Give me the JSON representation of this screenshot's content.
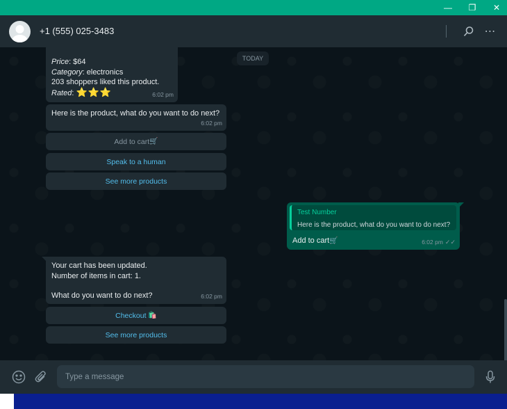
{
  "window": {
    "min_glyph": "—",
    "max_glyph": "❐",
    "close_glyph": "✕"
  },
  "header": {
    "contact_name": "+1 (555) 025-3483",
    "search_icon": "search-icon",
    "menu_icon": "more-options-icon",
    "menu_glyph": "⋯"
  },
  "chat": {
    "date_chip": "TODAY",
    "messages": [
      {
        "price_label": "Price",
        "price_value": ": $64",
        "category_label": "Category",
        "category_value": ": electronics",
        "liked": "203 shoppers liked this product.",
        "rated_label": "Rated",
        "rated_sep": ":",
        "stars": "⭐⭐⭐",
        "time": "6:02 pm"
      },
      {
        "text": "Here is the product, what do you want to do next?",
        "time": "6:02 pm"
      },
      {
        "quote_author": "Test Number",
        "quote_text": "Here is the product, what do you want to do next?",
        "text": "Add to cart",
        "emoji": "🛒",
        "time": "6:02 pm",
        "ticks": "✓✓"
      },
      {
        "line1": "Your cart has been updated.",
        "line2": "Number of items in cart: 1.",
        "line3": "What do you want to do next?",
        "time": "6:02 pm"
      }
    ],
    "replies_1": [
      {
        "label": "Add to cart",
        "emoji": "🛒",
        "state": "disabled"
      },
      {
        "label": "Speak to a human"
      },
      {
        "label": "See more products"
      }
    ],
    "replies_2": [
      {
        "label": "Checkout",
        "emoji": "🛍️"
      },
      {
        "label": "See more products"
      }
    ]
  },
  "composer": {
    "placeholder": "Type a message",
    "emoji_icon": "emoji-icon",
    "attach_icon": "paperclip-icon",
    "mic_icon": "microphone-icon"
  },
  "colors": {
    "accent": "#00a884",
    "header_bg": "#202c33",
    "chat_bg": "#0b141a",
    "incoming_bubble": "#202c33",
    "outgoing_bubble": "#005c4b",
    "link": "#53bdeb",
    "taskbar": "#0a1f8f"
  }
}
